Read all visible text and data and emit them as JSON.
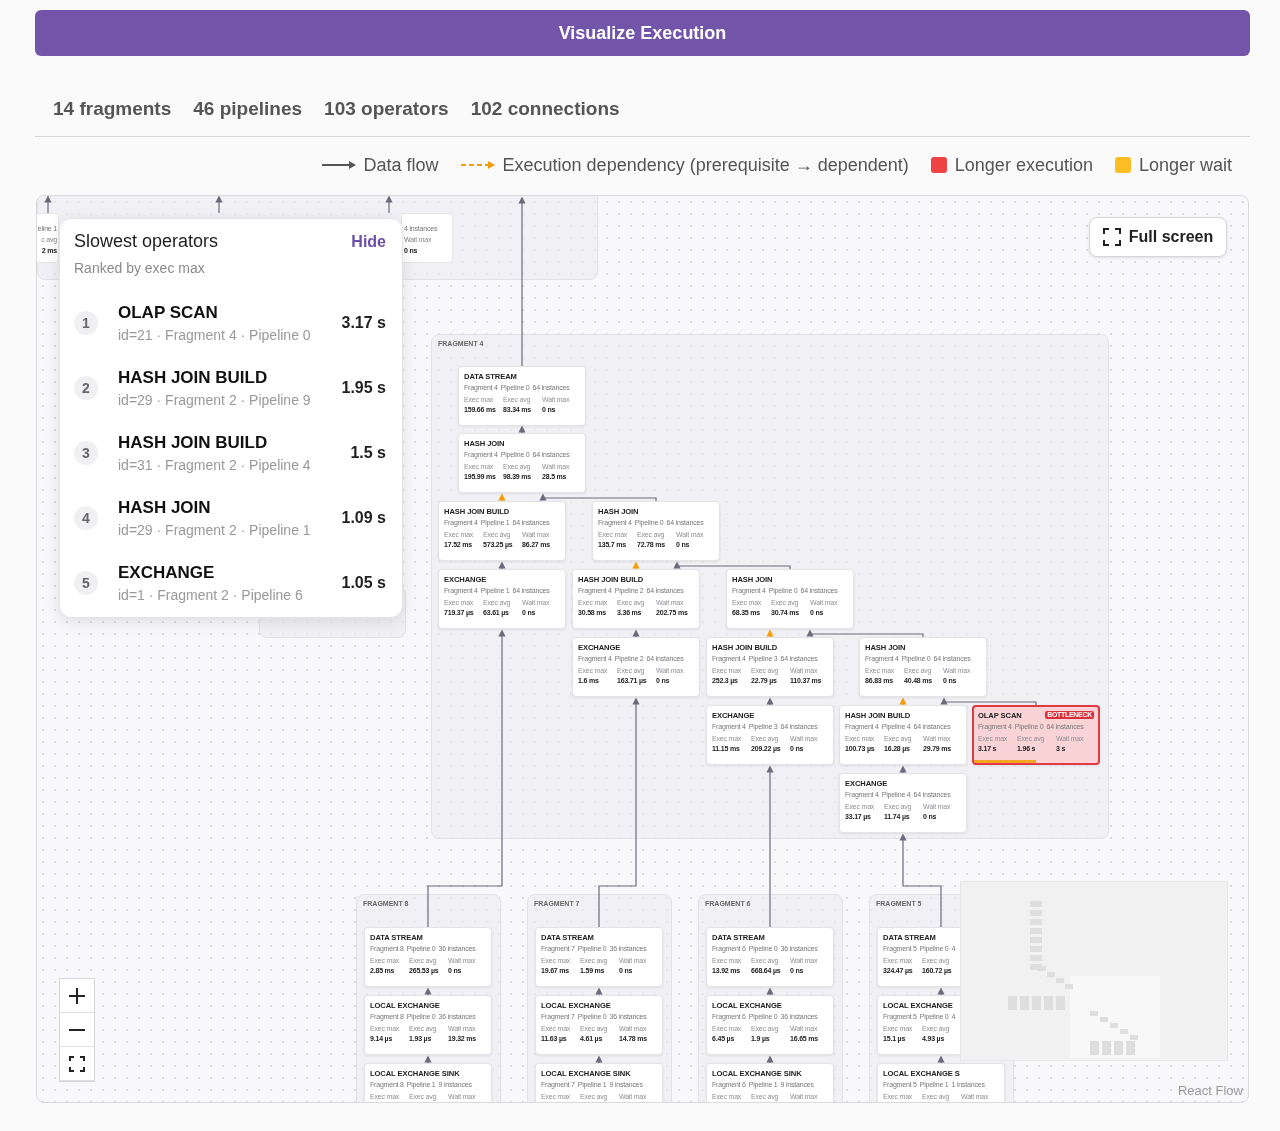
{
  "header": {
    "title": "Visualize Execution"
  },
  "stats": [
    "14 fragments",
    "46 pipelines",
    "103 operators",
    "102 connections"
  ],
  "legend": [
    {
      "kind": "flow",
      "label": "Data flow"
    },
    {
      "kind": "dependency",
      "label": "Execution dependency (prerequisite → dependent)"
    },
    {
      "kind": "swatch",
      "label": "Longer execution",
      "color": "#ef4444"
    },
    {
      "kind": "swatch",
      "label": "Longer wait",
      "color": "#fbbf24"
    }
  ],
  "top_strip": [
    {
      "lines": [
        "eline 1",
        "c avg",
        "2 ms"
      ]
    },
    {
      "lines": [
        "4 instances",
        "Wait max",
        "0 ns"
      ]
    }
  ],
  "fragments": [
    {
      "label": "FRAGMENT 4",
      "nodes": [
        {
          "title": "DATA STREAM",
          "fragment": "Fragment 4",
          "pipeline": "Pipeline 0",
          "instances": "64 instances",
          "metrics": [
            {
              "label": "Exec max",
              "value": "159.66 ms"
            },
            {
              "label": "Exec avg",
              "value": "83.34 ms"
            },
            {
              "label": "Wait max",
              "value": "0 ns"
            }
          ]
        },
        {
          "title": "HASH JOIN",
          "fragment": "Fragment 4",
          "pipeline": "Pipeline 0",
          "instances": "64 instances",
          "metrics": [
            {
              "label": "Exec max",
              "value": "195.99 ms"
            },
            {
              "label": "Exec avg",
              "value": "98.39 ms"
            },
            {
              "label": "Wait max",
              "value": "28.5 ms"
            }
          ]
        },
        {
          "title": "HASH JOIN BUILD",
          "fragment": "Fragment 4",
          "pipeline": "Pipeline 1",
          "instances": "64 instances",
          "metrics": [
            {
              "label": "Exec max",
              "value": "17.52 ms"
            },
            {
              "label": "Exec avg",
              "value": "573.25 µs"
            },
            {
              "label": "Wait max",
              "value": "86.27 ms"
            }
          ]
        },
        {
          "title": "HASH JOIN",
          "fragment": "Fragment 4",
          "pipeline": "Pipeline 0",
          "instances": "64 instances",
          "metrics": [
            {
              "label": "Exec max",
              "value": "135.7 ms"
            },
            {
              "label": "Exec avg",
              "value": "72.78 ms"
            },
            {
              "label": "Wait max",
              "value": "0 ns"
            }
          ]
        },
        {
          "title": "EXCHANGE",
          "fragment": "Fragment 4",
          "pipeline": "Pipeline 1",
          "instances": "64 instances",
          "metrics": [
            {
              "label": "Exec max",
              "value": "719.37 µs"
            },
            {
              "label": "Exec avg",
              "value": "63.61 µs"
            },
            {
              "label": "Wait max",
              "value": "0 ns"
            }
          ]
        },
        {
          "title": "HASH JOIN BUILD",
          "fragment": "Fragment 4",
          "pipeline": "Pipeline 2",
          "instances": "64 instances",
          "metrics": [
            {
              "label": "Exec max",
              "value": "30.58 ms"
            },
            {
              "label": "Exec avg",
              "value": "3.36 ms"
            },
            {
              "label": "Wait max",
              "value": "202.75 ms"
            }
          ]
        },
        {
          "title": "HASH JOIN",
          "fragment": "Fragment 4",
          "pipeline": "Pipeline 0",
          "instances": "64 instances",
          "metrics": [
            {
              "label": "Exec max",
              "value": "68.35 ms"
            },
            {
              "label": "Exec avg",
              "value": "30.74 ms"
            },
            {
              "label": "Wait max",
              "value": "0 ns"
            }
          ]
        },
        {
          "title": "EXCHANGE",
          "fragment": "Fragment 4",
          "pipeline": "Pipeline 2",
          "instances": "64 instances",
          "metrics": [
            {
              "label": "Exec max",
              "value": "1.6 ms"
            },
            {
              "label": "Exec avg",
              "value": "163.71 µs"
            },
            {
              "label": "Wait max",
              "value": "0 ns"
            }
          ]
        },
        {
          "title": "HASH JOIN BUILD",
          "fragment": "Fragment 4",
          "pipeline": "Pipeline 3",
          "instances": "64 instances",
          "metrics": [
            {
              "label": "Exec max",
              "value": "252.3 µs"
            },
            {
              "label": "Exec avg",
              "value": "22.79 µs"
            },
            {
              "label": "Wait max",
              "value": "110.37 ms"
            }
          ]
        },
        {
          "title": "HASH JOIN",
          "fragment": "Fragment 4",
          "pipeline": "Pipeline 0",
          "instances": "64 instances",
          "metrics": [
            {
              "label": "Exec max",
              "value": "86.83 ms"
            },
            {
              "label": "Exec avg",
              "value": "40.48 ms"
            },
            {
              "label": "Wait max",
              "value": "0 ns"
            }
          ]
        },
        {
          "title": "EXCHANGE",
          "fragment": "Fragment 4",
          "pipeline": "Pipeline 3",
          "instances": "64 instances",
          "metrics": [
            {
              "label": "Exec max",
              "value": "11.15 ms"
            },
            {
              "label": "Exec avg",
              "value": "209.22 µs"
            },
            {
              "label": "Wait max",
              "value": "0 ns"
            }
          ]
        },
        {
          "title": "HASH JOIN BUILD",
          "fragment": "Fragment 4",
          "pipeline": "Pipeline 4",
          "instances": "64 instances",
          "metrics": [
            {
              "label": "Exec max",
              "value": "100.73 µs"
            },
            {
              "label": "Exec avg",
              "value": "16.28 µs"
            },
            {
              "label": "Wait max",
              "value": "29.79 ms"
            }
          ]
        },
        {
          "title": "OLAP SCAN",
          "badge": "BOTTLENECK",
          "level": 0.5,
          "fragment": "Fragment 4",
          "pipeline": "Pipeline 0",
          "instances": "64 instances",
          "metrics": [
            {
              "label": "Exec max",
              "value": "3.17 s"
            },
            {
              "label": "Exec avg",
              "value": "1.96 s"
            },
            {
              "label": "Wait max",
              "value": "3 s"
            }
          ]
        },
        {
          "title": "EXCHANGE",
          "fragment": "Fragment 4",
          "pipeline": "Pipeline 4",
          "instances": "64 instances",
          "metrics": [
            {
              "label": "Exec max",
              "value": "33.17 µs"
            },
            {
              "label": "Exec avg",
              "value": "11.74 µs"
            },
            {
              "label": "Wait max",
              "value": "0 ns"
            }
          ]
        }
      ]
    },
    {
      "label": "FRAGMENT 8",
      "nodes": [
        {
          "title": "DATA STREAM",
          "fragment": "Fragment 8",
          "pipeline": "Pipeline 0",
          "instances": "36 instances",
          "metrics": [
            {
              "label": "Exec max",
              "value": "2.85 ms"
            },
            {
              "label": "Exec avg",
              "value": "265.53 µs"
            },
            {
              "label": "Wait max",
              "value": "0 ns"
            }
          ]
        },
        {
          "title": "LOCAL EXCHANGE",
          "fragment": "Fragment 8",
          "pipeline": "Pipeline 0",
          "instances": "36 instances",
          "metrics": [
            {
              "label": "Exec max",
              "value": "9.14 µs"
            },
            {
              "label": "Exec avg",
              "value": "1.93 µs"
            },
            {
              "label": "Wait max",
              "value": "19.32 ms"
            }
          ]
        },
        {
          "title": "LOCAL EXCHANGE SINK",
          "fragment": "Fragment 8",
          "pipeline": "Pipeline 1",
          "instances": "9 instances",
          "metrics": [
            {
              "label": "Exec max"
            },
            {
              "label": "Exec avg"
            },
            {
              "label": "Wait max"
            }
          ]
        }
      ]
    },
    {
      "label": "FRAGMENT 7",
      "nodes": [
        {
          "title": "DATA STREAM",
          "fragment": "Fragment 7",
          "pipeline": "Pipeline 0",
          "instances": "36 instances",
          "metrics": [
            {
              "label": "Exec max",
              "value": "19.67 ms"
            },
            {
              "label": "Exec avg",
              "value": "1.59 ms"
            },
            {
              "label": "Wait max",
              "value": "0 ns"
            }
          ]
        },
        {
          "title": "LOCAL EXCHANGE",
          "fragment": "Fragment 7",
          "pipeline": "Pipeline 0",
          "instances": "36 instances",
          "metrics": [
            {
              "label": "Exec max",
              "value": "11.63 µs"
            },
            {
              "label": "Exec avg",
              "value": "4.61 µs"
            },
            {
              "label": "Wait max",
              "value": "14.78 ms"
            }
          ]
        },
        {
          "title": "LOCAL EXCHANGE SINK",
          "fragment": "Fragment 7",
          "pipeline": "Pipeline 1",
          "instances": "9 instances",
          "metrics": [
            {
              "label": "Exec max"
            },
            {
              "label": "Exec avg"
            },
            {
              "label": "Wait max"
            }
          ]
        }
      ]
    },
    {
      "label": "FRAGMENT 6",
      "nodes": [
        {
          "title": "DATA STREAM",
          "fragment": "Fragment 6",
          "pipeline": "Pipeline 0",
          "instances": "36 instances",
          "metrics": [
            {
              "label": "Exec max",
              "value": "13.92 ms"
            },
            {
              "label": "Exec avg",
              "value": "668.64 µs"
            },
            {
              "label": "Wait max",
              "value": "0 ns"
            }
          ]
        },
        {
          "title": "LOCAL EXCHANGE",
          "fragment": "Fragment 6",
          "pipeline": "Pipeline 0",
          "instances": "36 instances",
          "metrics": [
            {
              "label": "Exec max",
              "value": "6.45 µs"
            },
            {
              "label": "Exec avg",
              "value": "1.9 µs"
            },
            {
              "label": "Wait max",
              "value": "16.65 ms"
            }
          ]
        },
        {
          "title": "LOCAL EXCHANGE SINK",
          "fragment": "Fragment 6",
          "pipeline": "Pipeline 1",
          "instances": "9 instances",
          "metrics": [
            {
              "label": "Exec max"
            },
            {
              "label": "Exec avg"
            },
            {
              "label": "Wait max"
            }
          ]
        }
      ]
    },
    {
      "label": "FRAGMENT 5",
      "nodes": [
        {
          "title": "DATA STREAM",
          "fragment": "Fragment 5",
          "pipeline": "Pipeline 0",
          "instances": "4",
          "metrics": [
            {
              "label": "Exec max",
              "value": "324.47 µs"
            },
            {
              "label": "Exec avg",
              "value": "160.72 µs"
            }
          ]
        },
        {
          "title": "LOCAL EXCHANGE",
          "fragment": "Fragment 5",
          "pipeline": "Pipeline 0",
          "instances": "4",
          "metrics": [
            {
              "label": "Exec max",
              "value": "15.1 µs"
            },
            {
              "label": "Exec avg",
              "value": "4.93 µs"
            }
          ]
        },
        {
          "title": "LOCAL EXCHANGE S",
          "fragment": "Fragment 5",
          "pipeline": "Pipeline 1",
          "instances": "1 instances",
          "metrics": [
            {
              "label": "Exec max"
            },
            {
              "label": "Exec avg"
            },
            {
              "label": "Wait max"
            }
          ]
        }
      ]
    }
  ],
  "panel": {
    "title": "Slowest operators",
    "hide": "Hide",
    "subtitle": "Ranked by exec max",
    "items": [
      {
        "rank": "1",
        "name": "OLAP SCAN",
        "detail": "id=21 · Fragment 4 · Pipeline 0",
        "value": "3.17 s"
      },
      {
        "rank": "2",
        "name": "HASH JOIN BUILD",
        "detail": "id=29 · Fragment 2 · Pipeline 9",
        "value": "1.95 s"
      },
      {
        "rank": "3",
        "name": "HASH JOIN BUILD",
        "detail": "id=31 · Fragment 2 · Pipeline 4",
        "value": "1.5 s"
      },
      {
        "rank": "4",
        "name": "HASH JOIN",
        "detail": "id=29 · Fragment 2 · Pipeline 1",
        "value": "1.09 s"
      },
      {
        "rank": "5",
        "name": "EXCHANGE",
        "detail": "id=1 · Fragment 2 · Pipeline 6",
        "value": "1.05 s"
      }
    ]
  },
  "fullscreen": {
    "label": "Full screen"
  },
  "attribution": "React Flow"
}
